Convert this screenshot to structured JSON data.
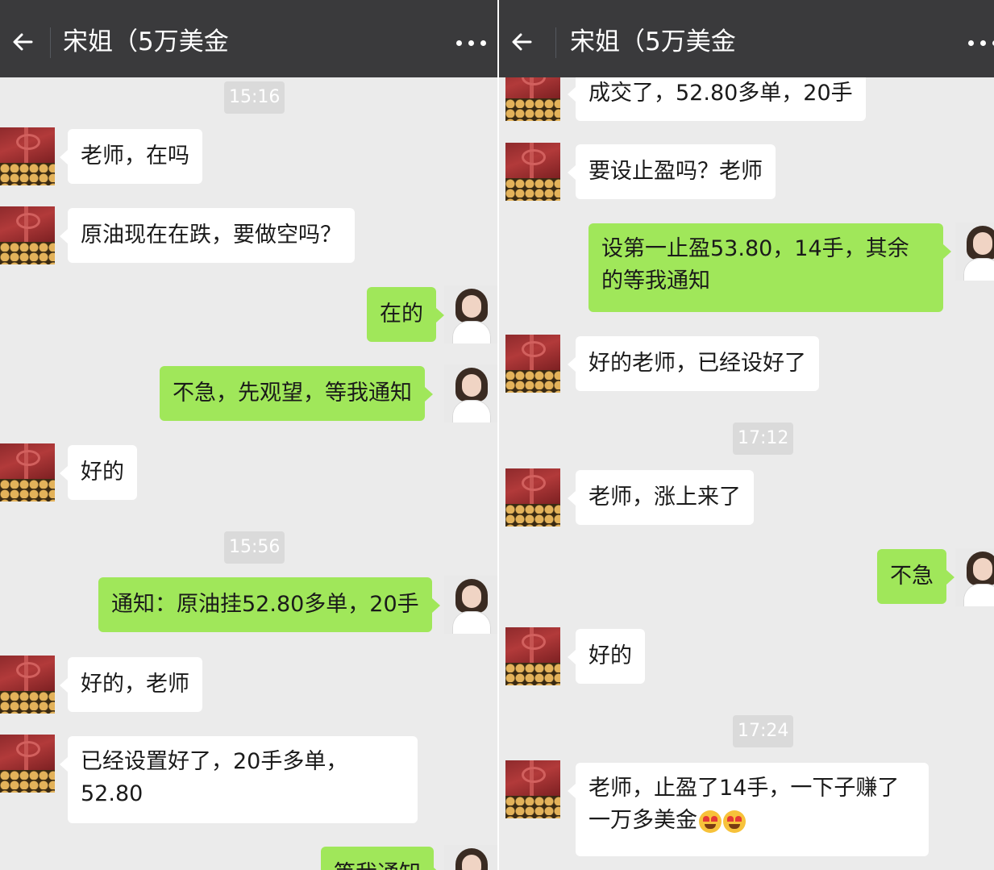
{
  "colors": {
    "header_bg": "#3a3a3c",
    "chat_bg": "#ebebeb",
    "sent_bubble": "#a0e75a",
    "received_bubble": "#ffffff",
    "time_badge": "#dadada"
  },
  "header": {
    "title": "宋姐（5万美金",
    "back_icon": "arrow-left-icon",
    "more_icon": "more-dots-icon"
  },
  "left_chat": {
    "times": [
      "15:16",
      "15:56"
    ],
    "messages": [
      {
        "side": "received",
        "text": "老师，在吗"
      },
      {
        "side": "received",
        "text": "原油现在在跌，要做空吗？"
      },
      {
        "side": "sent",
        "text": "在的"
      },
      {
        "side": "sent",
        "text": "不急，先观望，等我通知"
      },
      {
        "side": "received",
        "text": "好的"
      },
      {
        "side": "sent",
        "text": "通知：原油挂52.80多单，20手"
      },
      {
        "side": "received",
        "text": "好的，老师"
      },
      {
        "side": "received",
        "line1": "已经设置好了，20手多单，",
        "line2": "52.80"
      },
      {
        "side": "sent",
        "text": "等我通知"
      }
    ]
  },
  "right_chat": {
    "times": [
      "17:12",
      "17:24"
    ],
    "messages": [
      {
        "side": "received",
        "text": "成交了，52.80多单，20手"
      },
      {
        "side": "received",
        "text": "要设止盈吗？老师"
      },
      {
        "side": "sent",
        "line1": "设第一止盈53.80，14手，其余",
        "line2": "的等我通知"
      },
      {
        "side": "received",
        "text": "好的老师，已经设好了"
      },
      {
        "side": "received",
        "text": "老师，涨上来了"
      },
      {
        "side": "sent",
        "text": "不急"
      },
      {
        "side": "received",
        "text": "好的"
      },
      {
        "side": "received",
        "line1": "老师，止盈了14手，一下子赚了",
        "line2": "一万多美金",
        "emoji": "star-struck-face-icon"
      }
    ]
  }
}
